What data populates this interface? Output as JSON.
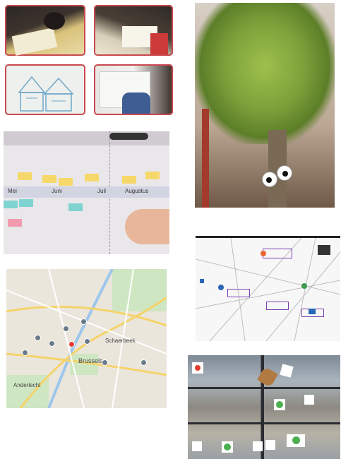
{
  "timeline": {
    "months": [
      "Mei",
      "Juni",
      "Juli",
      "Augustus"
    ]
  },
  "map": {
    "labels": {
      "schaerbeek": "Schaerbeek",
      "brussels": "Brussels",
      "anderlecht": "Anderlecht"
    }
  },
  "colors": {
    "frame_accent": "#c9484f",
    "sticky_yellow": "#f6d86a",
    "sticky_teal": "#7fd3d0",
    "sticky_pink": "#f29aae",
    "map_pin_red": "#e23b2e"
  }
}
